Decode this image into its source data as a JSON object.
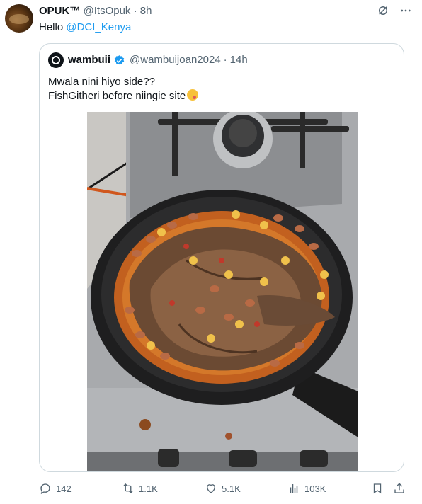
{
  "tweet": {
    "author_name": "OPUK™",
    "author_handle": "@ItsOpuk",
    "separator": "·",
    "time": "8h",
    "text_prefix": "Hello",
    "mention": "@DCI_Kenya"
  },
  "quoted": {
    "author_name": "wambuii",
    "author_handle": "@wambuijoan2024",
    "separator": "·",
    "time": "14h",
    "line1": "Mwala nini hiyo side??",
    "line2": "FishGitheri before niingie site",
    "emoji": "face-savoring-food"
  },
  "actions": {
    "replies": "142",
    "reposts": "1.1K",
    "likes": "5.1K",
    "views": "103K"
  },
  "colors": {
    "accent": "#1d9bf0",
    "text": "#0f1419",
    "muted": "#536471",
    "border": "#cfd9de"
  }
}
